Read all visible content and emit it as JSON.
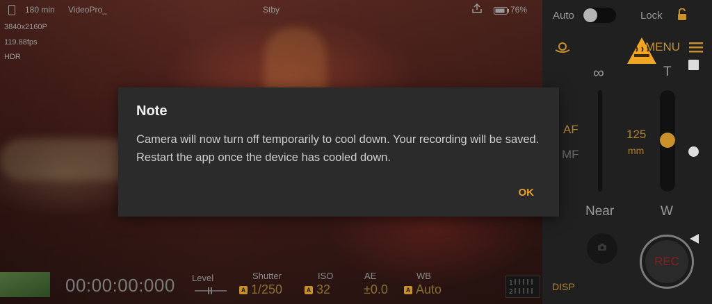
{
  "status_bar": {
    "record_time": "180 min",
    "app_name": "VideoPro_",
    "state": "Stby",
    "battery": "76%"
  },
  "video_info": {
    "resolution": "3840x2160P",
    "fps": "119.88fps",
    "mode": "HDR"
  },
  "panel": {
    "auto_label": "Auto",
    "lock_label": "Lock",
    "menu_label": "MENU",
    "zoom_wide_symbol": "∞",
    "zoom_tele_label": "T",
    "af_label": "AF",
    "mf_label": "MF",
    "focal_value": "125",
    "focal_unit": "mm",
    "near_label": "Near",
    "wide_label": "W",
    "rec_label": "REC",
    "disp_label": "DISP",
    "auto_toggle_on": false,
    "focus_slider_level": 0.52
  },
  "bottom_bar": {
    "timecode": "00:00:00:000",
    "level_label": "Level",
    "shutter_label": "Shutter",
    "shutter_value": "1/250",
    "iso_label": "ISO",
    "iso_value": "32",
    "ae_label": "AE",
    "ae_value": "±0.0",
    "wb_label": "WB",
    "wb_value": "Auto",
    "auto_badge": "A"
  },
  "dialog": {
    "title": "Note",
    "message": "Camera will now turn off temporarily to cool down. Your recording will be saved. Restart the app once the device has cooled down.",
    "ok_label": "OK"
  },
  "colors": {
    "accent": "#e8a12e",
    "warning": "#f0a524",
    "rec_red": "#8a1d1d"
  }
}
